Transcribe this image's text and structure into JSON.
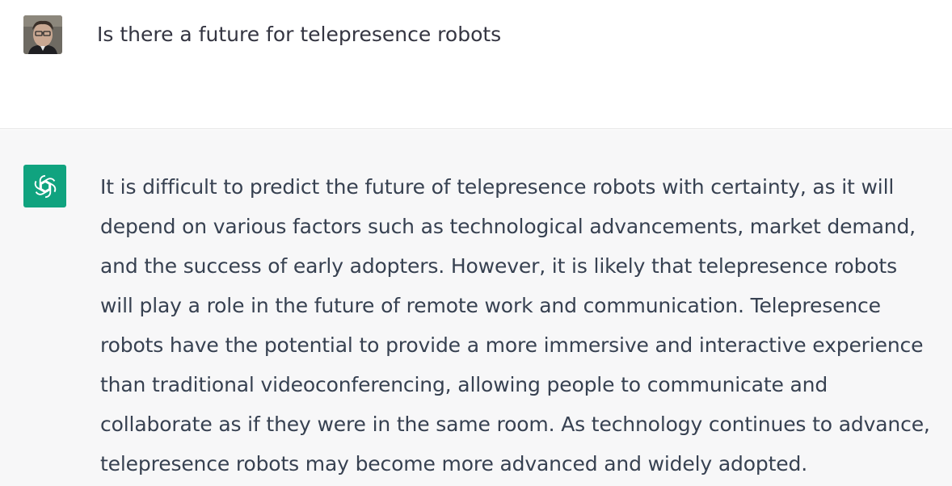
{
  "conversation": {
    "user": {
      "message": "Is there a future for telepresence robots"
    },
    "assistant": {
      "message": "It is difficult to predict the future of telepresence robots with certainty, as it will depend on various factors such as technological advancements, market demand, and the success of early adopters. However, it is likely that telepresence robots will play a role in the future of remote work and communication. Telepresence robots have the potential to provide a more immersive and interactive experience than traditional videoconferencing, allowing people to communicate and collaborate as if they were in the same room. As technology continues to advance, telepresence robots may become more advanced and widely adopted.",
      "avatar_icon": "openai-logo-icon",
      "avatar_color": "#10a37f"
    }
  }
}
